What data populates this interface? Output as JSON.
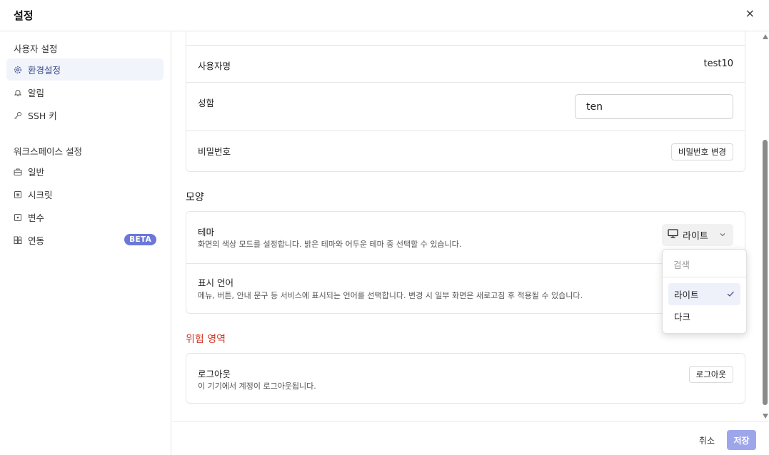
{
  "header": {
    "title": "설정",
    "close": "×"
  },
  "sidebar": {
    "user_section": "사용자 설정",
    "user_items": [
      {
        "label": "환경설정",
        "icon": "gear-icon",
        "active": true
      },
      {
        "label": "알림",
        "icon": "bell-icon"
      },
      {
        "label": "SSH 키",
        "icon": "key-icon"
      }
    ],
    "workspace_section": "워크스페이스 설정",
    "workspace_items": [
      {
        "label": "일반",
        "icon": "briefcase-icon"
      },
      {
        "label": "시크릿",
        "icon": "secret-icon"
      },
      {
        "label": "변수",
        "icon": "variable-icon"
      },
      {
        "label": "연동",
        "icon": "integration-icon",
        "badge": "BETA"
      }
    ]
  },
  "account": {
    "username_label": "사용자명",
    "username_value": "test10",
    "fullname_label": "성함",
    "fullname_value": "ten",
    "password_label": "비밀번호",
    "password_button": "비밀번호 변경"
  },
  "appearance": {
    "title": "모양",
    "theme_label": "테마",
    "theme_desc": "화면의 색상 모드를 설정합니다. 밝은 테마와 어두운 테마 중 선택할 수 있습니다.",
    "theme_value": "라이트",
    "language_label": "표시 언어",
    "language_desc": "메뉴, 버튼, 안내 문구 등 서비스에 표시되는 언어를 선택합니다. 변경 시 일부 화면은 새로고침 후 적용될 수 있습니다."
  },
  "dropdown": {
    "search_placeholder": "검색",
    "options": [
      "라이트",
      "다크"
    ],
    "selected": "라이트"
  },
  "danger": {
    "title": "위험 영역",
    "logout_label": "로그아웃",
    "logout_desc": "이 기기에서 계정이 로그아웃됩니다.",
    "logout_button": "로그아웃"
  },
  "footer": {
    "cancel": "취소",
    "save": "저장"
  },
  "colors": {
    "accent": "#6b78d8",
    "save_button": "#9da6ea",
    "danger": "#d13b2a",
    "active_bg": "#f1f4fa"
  }
}
